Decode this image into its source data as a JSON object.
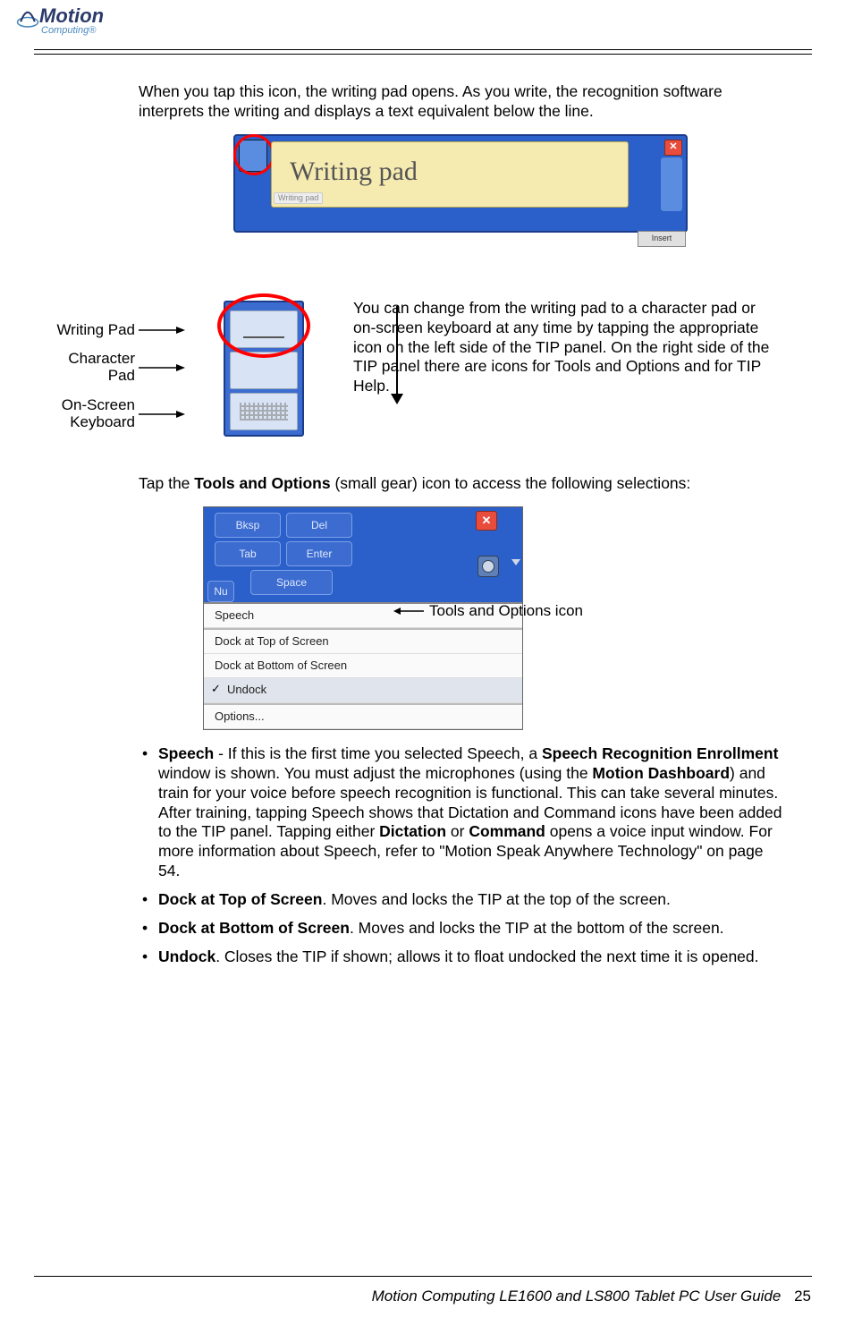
{
  "header": {
    "brand_line1": "Motion",
    "brand_line2": "Computing®"
  },
  "intro_para": "When you tap this icon, the writing pad opens. As you write, the recognition software interprets the writing and displays a text equivalent below the line.",
  "tip_panel": {
    "handwriting_text": "Writing pad",
    "tag_text": "Writing   pad",
    "close_glyph": "✕",
    "insert_label": "Insert"
  },
  "mode_labels": {
    "writing": "Writing Pad",
    "character": "Character Pad",
    "keyboard_l1": "On-Screen",
    "keyboard_l2": "Keyboard"
  },
  "mode_description": "You can change from the writing pad to a character pad or on-screen keyboard at any time by tapping the appropriate icon on the left side of the TIP panel. On the right side of the TIP panel there are icons for Tools and Options and for TIP Help.",
  "tools_intro_pre": "Tap the ",
  "tools_intro_bold": "Tools and Options",
  "tools_intro_post": " (small gear) icon to access the following selections:",
  "tools_shot": {
    "keys": {
      "bksp": "Bksp",
      "del": "Del",
      "tab": "Tab",
      "enter": "Enter",
      "space": "Space",
      "nu": "Nu"
    },
    "close_glyph": "✕",
    "menu": {
      "speech": "Speech",
      "dock_top": "Dock at Top of Screen",
      "dock_bottom": "Dock at Bottom of Screen",
      "undock": "Undock",
      "options": "Options..."
    }
  },
  "tools_callout": "Tools and Options icon",
  "bullets": {
    "speech": {
      "b1": "Speech",
      "t1": " - If this is the first time you selected Speech, a ",
      "b2": "Speech Recog­nition Enrollment",
      "t2": " window is shown. You must adjust the microphones (using the ",
      "b3": "Motion Dashboard",
      "t3": ") and train for your voice before speech recognition is functional. This can take several minutes. After training, tapping Speech shows that Dictation and Command icons have been added to the TIP panel. Tapping either ",
      "b4": "Dictation",
      "t4": " or ",
      "b5": "Command",
      "t5": " opens a voice input window. For more information about Speech, refer to \"Motion Speak Anywhere Technology\" on page 54."
    },
    "dock_top": {
      "b": "Dock at Top of Screen",
      "t": ". Moves and locks the TIP at the top of the screen."
    },
    "dock_bottom": {
      "b": "Dock at Bottom of Screen",
      "t": ". Moves and locks the TIP at the bottom of the screen."
    },
    "undock": {
      "b": "Undock",
      "t": ". Closes the TIP if shown; allows it to float undocked the next time it is opened."
    }
  },
  "footer": {
    "text": "Motion Computing LE1600 and LS800 Tablet PC User Guide",
    "page": "25"
  }
}
